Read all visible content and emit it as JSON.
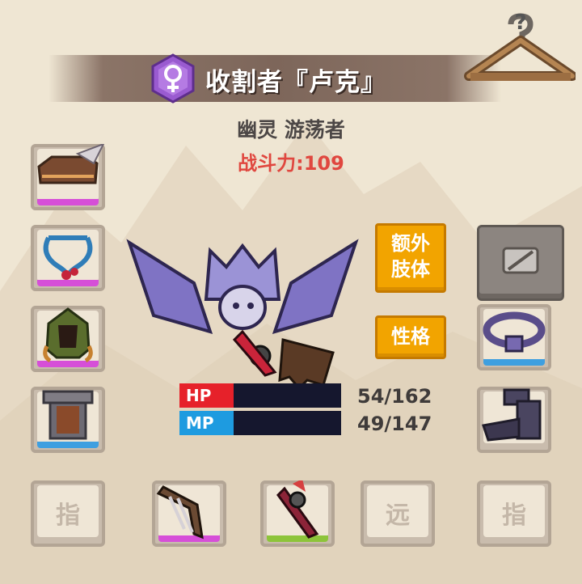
{
  "character": {
    "name": "收割者『卢克』",
    "gender_icon": "female-symbol-icon",
    "classes": "幽灵 游荡者",
    "power_label": "战斗力:109"
  },
  "buttons": {
    "extra_limbs": [
      "额外",
      "肢体"
    ],
    "personality": "性格",
    "wardrobe_icon": "hanger-icon",
    "wardrobe_badge": "?",
    "locked_slot_icon": "locked-slot-icon"
  },
  "stats": {
    "hp": {
      "label": "HP",
      "value": "54/162",
      "fraction": 0.333
    },
    "mp": {
      "label": "MP",
      "value": "49/147",
      "fraction": 0.333
    }
  },
  "slots": {
    "left": [
      {
        "item": "helmet-icon",
        "rarity": "pink"
      },
      {
        "item": "necklace-icon",
        "rarity": "pink"
      },
      {
        "item": "hood-mask-icon",
        "rarity": "pink"
      },
      {
        "item": "armor-icon",
        "rarity": "blue"
      }
    ],
    "right": [
      {
        "item": "belt-icon",
        "rarity": "blue"
      },
      {
        "item": "gauntlet-icon",
        "rarity": "none"
      }
    ],
    "bottom": [
      {
        "label": "指",
        "empty": true
      },
      {
        "item": "claw-weapon-icon",
        "rarity": "pink"
      },
      {
        "item": "scythe-weapon-icon",
        "rarity": "green"
      },
      {
        "label": "远",
        "empty": true
      },
      {
        "label": "指",
        "empty": true
      }
    ]
  },
  "colors": {
    "pink_rarity": "#d64fd8",
    "blue_rarity": "#3e9fe0",
    "green_rarity": "#8dc43a",
    "hp_bar": "#e6212a",
    "mp_bar": "#1e9be0",
    "power_text": "#e0473f",
    "button_orange": "#f2a400"
  }
}
